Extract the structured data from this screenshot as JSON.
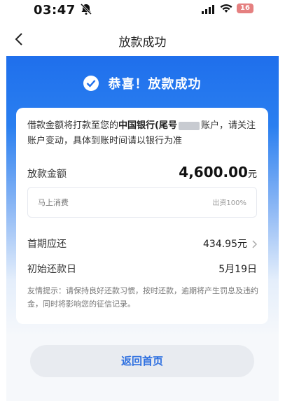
{
  "status_bar": {
    "time": "03:47",
    "battery": "16"
  },
  "nav": {
    "title": "放款成功"
  },
  "header": {
    "title": "恭喜！放款成功"
  },
  "notice": {
    "prefix": "借款金额将打款至您的",
    "bank": "中国银行(尾号",
    "suffix": "账户，请关注账户变动，具体到账时间请以银行为准"
  },
  "loan": {
    "label": "放款金额",
    "amount": "4,600.00",
    "unit": "元",
    "product": "马上消费",
    "funding": "出资100%"
  },
  "first_repayment": {
    "label": "首期应还",
    "value": "434.95元"
  },
  "initial_repay_date": {
    "label": "初始还款日",
    "value": "5月19日"
  },
  "tips": "友情提示：请保持良好还款习惯，按时还款，逾期将产生罚息及违约金，同时将影响您的征信记录。",
  "button": {
    "label": "返回首页"
  },
  "colors": {
    "accent": "#1f6fec",
    "button_text": "#2d6fe0"
  }
}
